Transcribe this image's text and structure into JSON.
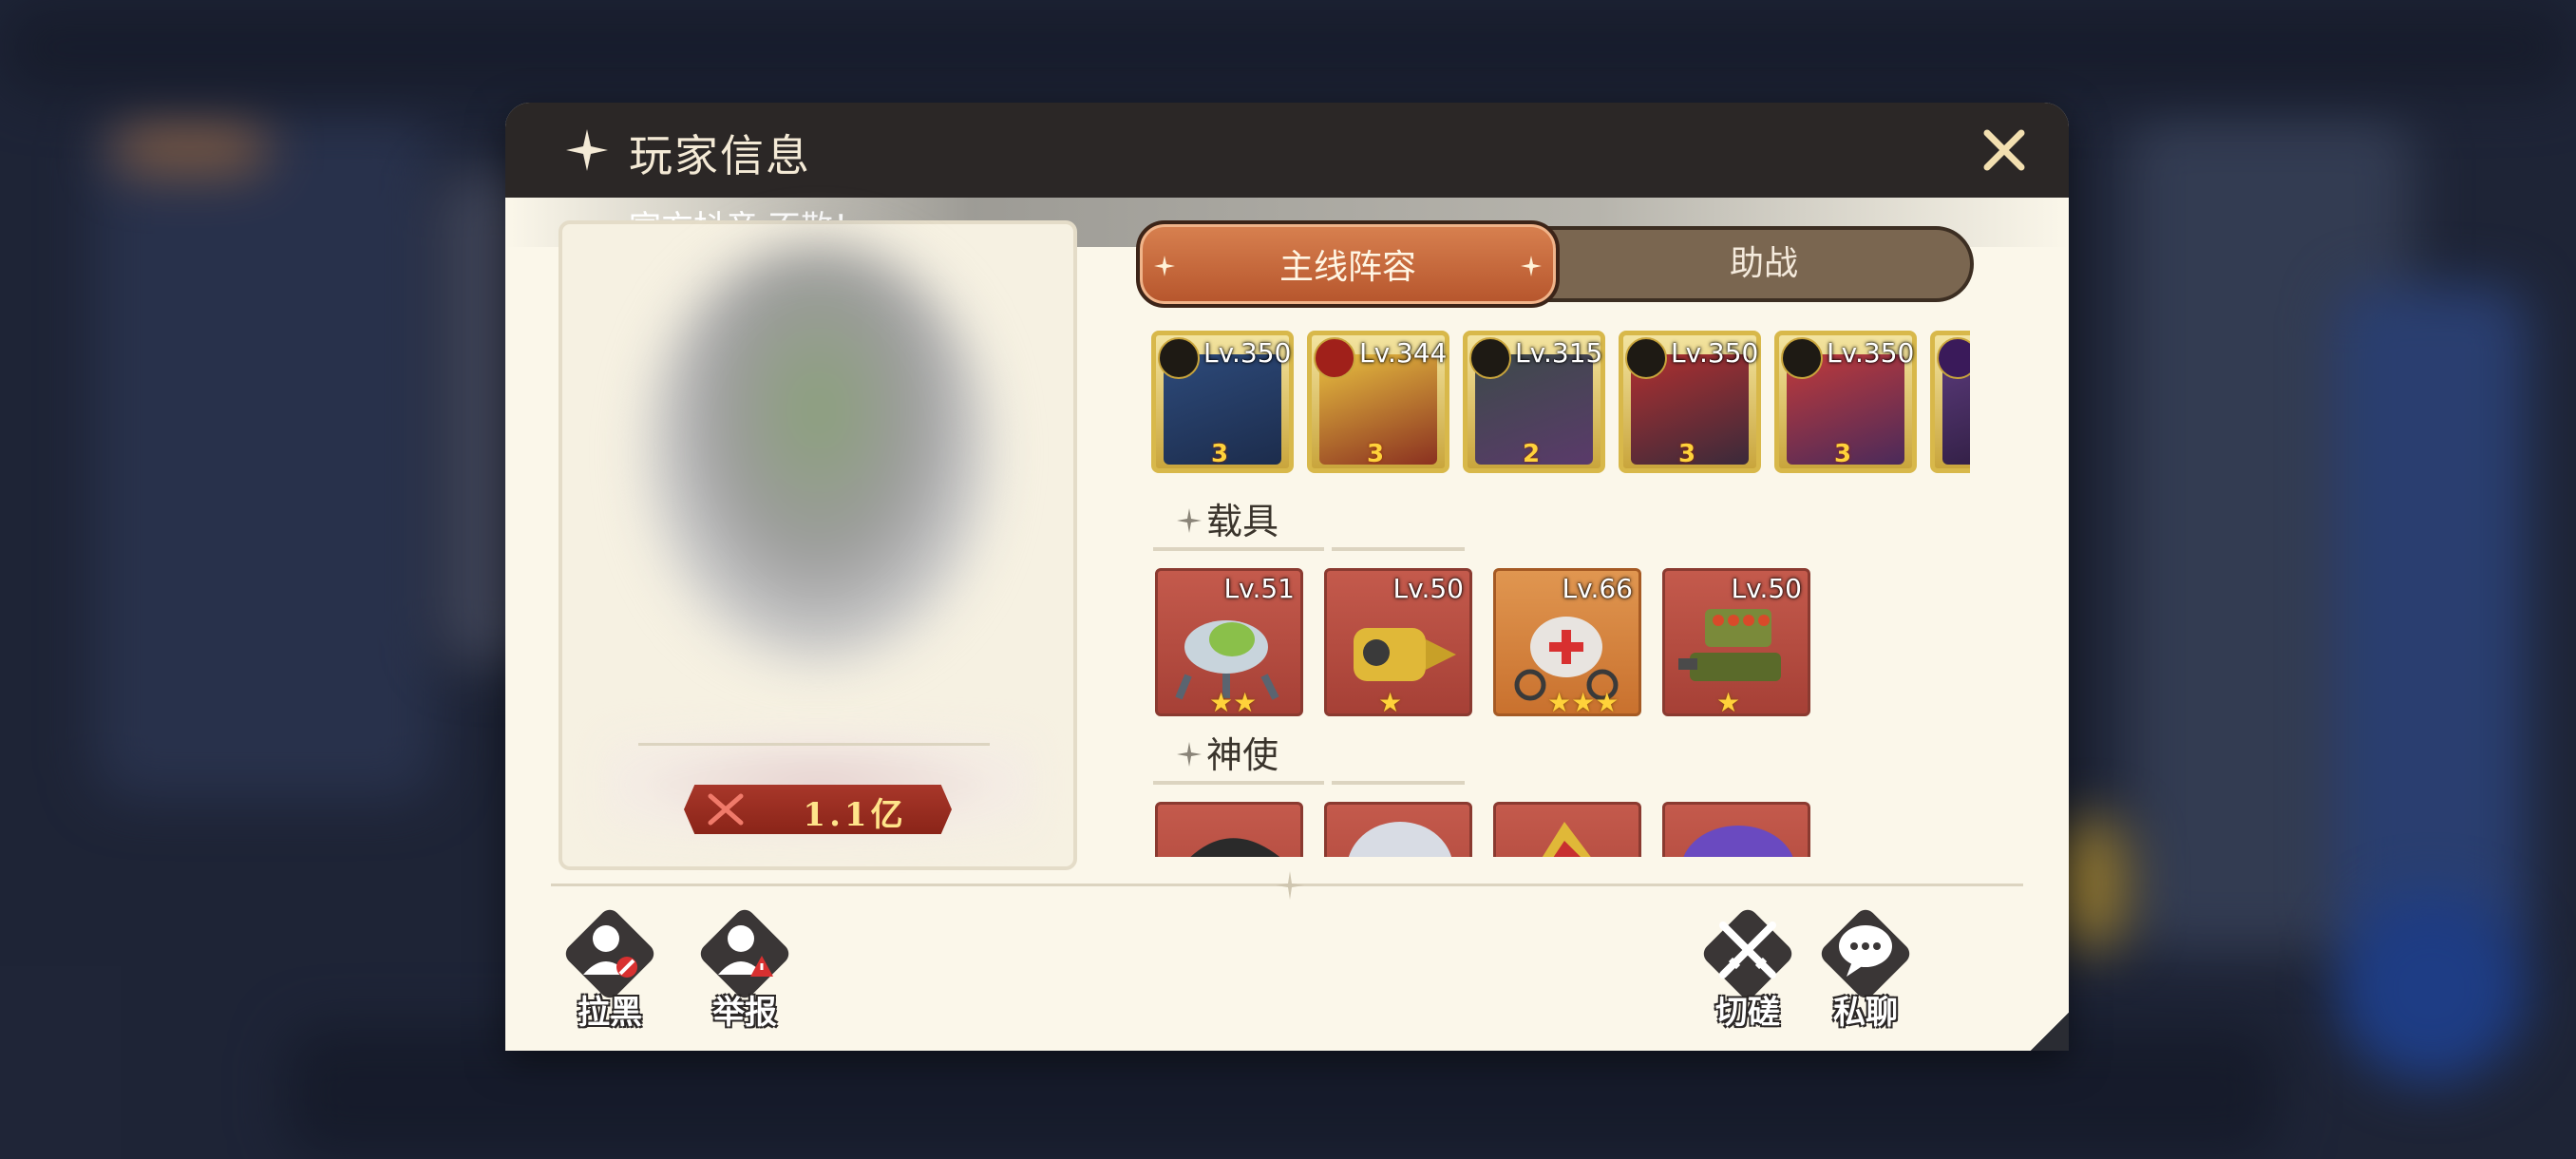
{
  "window": {
    "title": "玩家信息"
  },
  "notice": {
    "text": "官方抖音 不散！"
  },
  "player": {
    "power": "1.1亿"
  },
  "tabs": [
    {
      "label": "主线阵容",
      "active": true
    },
    {
      "label": "助战",
      "active": false
    }
  ],
  "heroes": [
    {
      "level": "Lv.350",
      "stars": "3",
      "faction": "gold-emblem-icon",
      "color": "#2d4a7a"
    },
    {
      "level": "Lv.344",
      "stars": "3",
      "faction": "r-emblem-icon",
      "color": "#c7a23a"
    },
    {
      "level": "Lv.315",
      "stars": "2",
      "faction": "gold-emblem-icon",
      "color": "#3d4a4a"
    },
    {
      "level": "Lv.350",
      "stars": "3",
      "faction": "gold-emblem-icon",
      "color": "#8a2d2d"
    },
    {
      "level": "Lv.350",
      "stars": "3",
      "faction": "gold-emblem-icon",
      "color": "#6a2d5a"
    },
    {
      "level": "",
      "stars": "",
      "faction": "purple-emblem-icon",
      "color": "#5a3a7a"
    }
  ],
  "sections": {
    "vehicles": "载具",
    "envoys": "神使"
  },
  "vehicles": [
    {
      "level": "Lv.51",
      "stars": "★★",
      "frame": "red",
      "art": "green-mech-icon"
    },
    {
      "level": "Lv.50",
      "stars": "★",
      "frame": "red",
      "art": "gold-drill-icon"
    },
    {
      "level": "Lv.66",
      "stars": "★★★",
      "frame": "orange",
      "art": "medic-drone-icon"
    },
    {
      "level": "Lv.50",
      "stars": "★",
      "frame": "red",
      "art": "missile-tank-icon"
    }
  ],
  "envoys": [
    {
      "frame": "red",
      "art": "dark-horn-icon"
    },
    {
      "frame": "red",
      "art": "silver-orb-icon"
    },
    {
      "frame": "red",
      "art": "gold-crest-icon"
    },
    {
      "frame": "red",
      "art": "violet-wing-icon"
    }
  ],
  "actions": {
    "block": "拉黑",
    "report": "举报",
    "spar": "切磋",
    "chat": "私聊"
  },
  "colors": {
    "panel": "#fbf7ea",
    "titlebar": "#2b2726",
    "tab_active": "#c76a3c",
    "power_badge": "#9a2e22",
    "hero_frame": "#d8b84a"
  }
}
